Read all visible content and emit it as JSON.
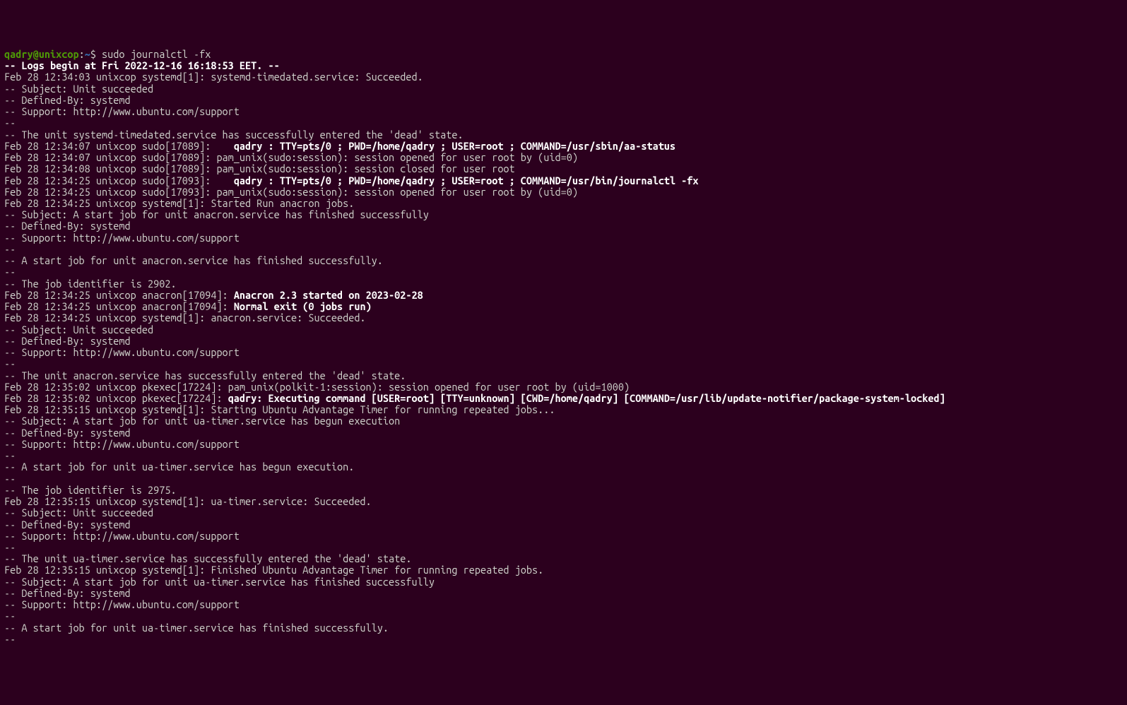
{
  "prompt": {
    "user_host": "qadry@unixcop",
    "colon": ":",
    "cwd": "~",
    "dollar": "$",
    "command": " sudo journalctl -fx"
  },
  "lines": [
    {
      "t": "b",
      "text": "-- Logs begin at Fri 2022-12-16 16:18:53 EET. --"
    },
    {
      "t": "n",
      "text": "Feb 28 12:34:03 unixcop systemd[1]: systemd-timedated.service: Succeeded."
    },
    {
      "t": "n",
      "text": "-- Subject: Unit succeeded"
    },
    {
      "t": "n",
      "text": "-- Defined-By: systemd"
    },
    {
      "t": "n",
      "text": "-- Support: http://www.ubuntu.com/support"
    },
    {
      "t": "n",
      "text": "-- "
    },
    {
      "t": "n",
      "text": "-- The unit systemd-timedated.service has successfully entered the 'dead' state."
    },
    {
      "t": "m",
      "pre": "Feb 28 12:34:07 unixcop sudo[17089]:    ",
      "bold": "qadry : TTY=pts/0 ; PWD=/home/qadry ; USER=root ; COMMAND=/usr/sbin/aa-status"
    },
    {
      "t": "n",
      "text": "Feb 28 12:34:07 unixcop sudo[17089]: pam_unix(sudo:session): session opened for user root by (uid=0)"
    },
    {
      "t": "n",
      "text": "Feb 28 12:34:08 unixcop sudo[17089]: pam_unix(sudo:session): session closed for user root"
    },
    {
      "t": "m",
      "pre": "Feb 28 12:34:25 unixcop sudo[17093]:    ",
      "bold": "qadry : TTY=pts/0 ; PWD=/home/qadry ; USER=root ; COMMAND=/usr/bin/journalctl -fx"
    },
    {
      "t": "n",
      "text": "Feb 28 12:34:25 unixcop sudo[17093]: pam_unix(sudo:session): session opened for user root by (uid=0)"
    },
    {
      "t": "n",
      "text": "Feb 28 12:34:25 unixcop systemd[1]: Started Run anacron jobs."
    },
    {
      "t": "n",
      "text": "-- Subject: A start job for unit anacron.service has finished successfully"
    },
    {
      "t": "n",
      "text": "-- Defined-By: systemd"
    },
    {
      "t": "n",
      "text": "-- Support: http://www.ubuntu.com/support"
    },
    {
      "t": "n",
      "text": "-- "
    },
    {
      "t": "n",
      "text": "-- A start job for unit anacron.service has finished successfully."
    },
    {
      "t": "n",
      "text": "-- "
    },
    {
      "t": "n",
      "text": "-- The job identifier is 2902."
    },
    {
      "t": "m",
      "pre": "Feb 28 12:34:25 unixcop anacron[17094]: ",
      "bold": "Anacron 2.3 started on 2023-02-28"
    },
    {
      "t": "m",
      "pre": "Feb 28 12:34:25 unixcop anacron[17094]: ",
      "bold": "Normal exit (0 jobs run)"
    },
    {
      "t": "n",
      "text": "Feb 28 12:34:25 unixcop systemd[1]: anacron.service: Succeeded."
    },
    {
      "t": "n",
      "text": "-- Subject: Unit succeeded"
    },
    {
      "t": "n",
      "text": "-- Defined-By: systemd"
    },
    {
      "t": "n",
      "text": "-- Support: http://www.ubuntu.com/support"
    },
    {
      "t": "n",
      "text": "-- "
    },
    {
      "t": "n",
      "text": "-- The unit anacron.service has successfully entered the 'dead' state."
    },
    {
      "t": "n",
      "text": "Feb 28 12:35:02 unixcop pkexec[17224]: pam_unix(polkit-1:session): session opened for user root by (uid=1000)"
    },
    {
      "t": "m",
      "pre": "Feb 28 12:35:02 unixcop pkexec[17224]: ",
      "bold": "qadry: Executing command [USER=root] [TTY=unknown] [CWD=/home/qadry] [COMMAND=/usr/lib/update-notifier/package-system-locked]"
    },
    {
      "t": "n",
      "text": "Feb 28 12:35:15 unixcop systemd[1]: Starting Ubuntu Advantage Timer for running repeated jobs..."
    },
    {
      "t": "n",
      "text": "-- Subject: A start job for unit ua-timer.service has begun execution"
    },
    {
      "t": "n",
      "text": "-- Defined-By: systemd"
    },
    {
      "t": "n",
      "text": "-- Support: http://www.ubuntu.com/support"
    },
    {
      "t": "n",
      "text": "-- "
    },
    {
      "t": "n",
      "text": "-- A start job for unit ua-timer.service has begun execution."
    },
    {
      "t": "n",
      "text": "-- "
    },
    {
      "t": "n",
      "text": "-- The job identifier is 2975."
    },
    {
      "t": "n",
      "text": "Feb 28 12:35:15 unixcop systemd[1]: ua-timer.service: Succeeded."
    },
    {
      "t": "n",
      "text": "-- Subject: Unit succeeded"
    },
    {
      "t": "n",
      "text": "-- Defined-By: systemd"
    },
    {
      "t": "n",
      "text": "-- Support: http://www.ubuntu.com/support"
    },
    {
      "t": "n",
      "text": "-- "
    },
    {
      "t": "n",
      "text": "-- The unit ua-timer.service has successfully entered the 'dead' state."
    },
    {
      "t": "n",
      "text": "Feb 28 12:35:15 unixcop systemd[1]: Finished Ubuntu Advantage Timer for running repeated jobs."
    },
    {
      "t": "n",
      "text": "-- Subject: A start job for unit ua-timer.service has finished successfully"
    },
    {
      "t": "n",
      "text": "-- Defined-By: systemd"
    },
    {
      "t": "n",
      "text": "-- Support: http://www.ubuntu.com/support"
    },
    {
      "t": "n",
      "text": "-- "
    },
    {
      "t": "n",
      "text": "-- A start job for unit ua-timer.service has finished successfully."
    },
    {
      "t": "n",
      "text": "-- "
    }
  ]
}
